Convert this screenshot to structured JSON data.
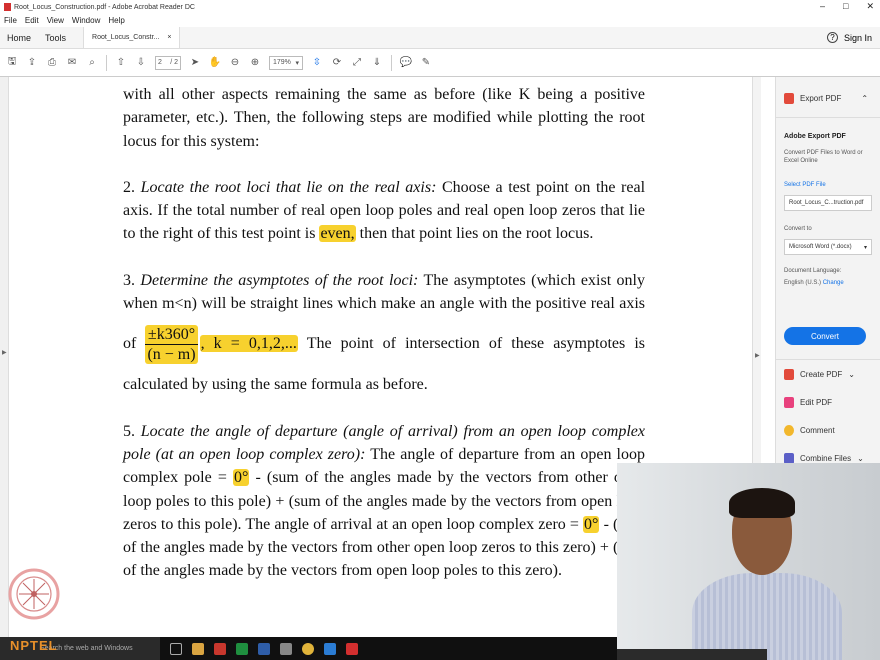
{
  "window": {
    "title": "Root_Locus_Construction.pdf - Adobe Acrobat Reader DC",
    "controls": [
      "–",
      "□",
      "✕"
    ]
  },
  "menu": [
    "File",
    "Edit",
    "View",
    "Window",
    "Help"
  ],
  "tabs": {
    "home": "Home",
    "tools": "Tools",
    "doc_tab": "Root_Locus_Constr...",
    "doc_tab_close": "×",
    "sign_in": "Sign In"
  },
  "toolbar": {
    "page_current": "2",
    "page_total": "/ 2",
    "zoom": "179%"
  },
  "document": {
    "intro": "with all other aspects remaining the same as before (like K being a positive parameter, etc.). Then, the following steps are modified while plotting the root locus for this system:",
    "step2_num": "2.",
    "step2_title": "Locate the root loci that lie on the real axis:",
    "step2_body_a": "Choose a test point on the real axis. If the total number of real open loop poles and real open loop zeros that lie to the right of this test point is",
    "step2_even": "even,",
    "step2_body_b": "then that point lies on the root locus.",
    "step3_num": "3.",
    "step3_title": "Determine the asymptotes of the root loci:",
    "step3_body_a": "The asymptotes (which exist only when m<n) will be straight lines which make an angle with the positive real axis of",
    "step3_frac_num": "±k360°",
    "step3_frac_den": "(n − m)",
    "step3_k": ", k = 0,1,2,...",
    "step3_body_b": "The point of intersection of these asymptotes is calculated by using the same formula as before.",
    "step5_num": "5.",
    "step5_title": "Locate the angle of departure (angle of arrival) from an open loop complex pole (at an open loop complex zero):",
    "step5_body_a": "The angle of departure from an open loop complex pole =",
    "step5_zero_a": "0°",
    "step5_body_b": "- (sum of the angles made by the vectors from other open loop poles to this pole) + (sum of the angles made by the vectors from open loop zeros to this pole). The angle of arrival at an open loop complex zero =",
    "step5_zero_b": "0°",
    "step5_body_c": "- (sum of the angles made by the vectors from other open loop zeros to this zero) + (sum of the angles made by the vectors from open loop poles to this zero)."
  },
  "right_panel": {
    "export_pdf": "Export PDF",
    "adobe_export_title": "Adobe Export PDF",
    "adobe_export_desc": "Convert PDF Files to Word or Excel Online",
    "select_pdf": "Select PDF File",
    "file_name": "Root_Locus_C...truction.pdf",
    "convert_to": "Convert to",
    "format": "Microsoft Word (*.docx)",
    "doc_language_label": "Document Language:",
    "doc_language": "English (U.S.)",
    "change": "Change",
    "convert_button": "Convert",
    "create_pdf": "Create PDF",
    "edit_pdf": "Edit PDF",
    "comment": "Comment",
    "combine_files": "Combine Files"
  },
  "taskbar": {
    "search_placeholder": "Search the web and Windows"
  },
  "watermark": {
    "nptel": "NPTEL"
  },
  "colors": {
    "highlight": "#f7d12e",
    "accent": "#1473e6",
    "pdf_red": "#d32f2f"
  }
}
